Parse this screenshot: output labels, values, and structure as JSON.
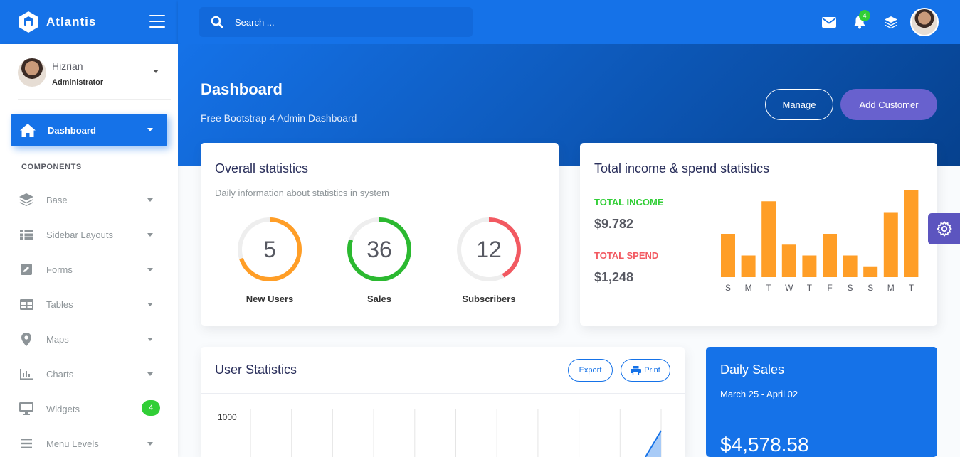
{
  "brand": {
    "name": "Atlantis"
  },
  "search": {
    "placeholder": "Search ..."
  },
  "navbar": {
    "notification_count": "4"
  },
  "user": {
    "name": "Hizrian",
    "role": "Administrator"
  },
  "sidebar": {
    "active": {
      "label": "Dashboard",
      "icon": "home-icon"
    },
    "section_label": "COMPONENTS",
    "items": [
      {
        "label": "Base",
        "icon": "layers-icon"
      },
      {
        "label": "Sidebar Layouts",
        "icon": "th-list-icon"
      },
      {
        "label": "Forms",
        "icon": "pen-square-icon"
      },
      {
        "label": "Tables",
        "icon": "table-icon"
      },
      {
        "label": "Maps",
        "icon": "map-marker-icon"
      },
      {
        "label": "Charts",
        "icon": "bar-chart-icon"
      },
      {
        "label": "Widgets",
        "icon": "desktop-icon",
        "badge": "4"
      },
      {
        "label": "Menu Levels",
        "icon": "bars-icon"
      }
    ]
  },
  "header": {
    "title": "Dashboard",
    "subtitle": "Free Bootstrap 4 Admin Dashboard",
    "manage_label": "Manage",
    "add_customer_label": "Add Customer"
  },
  "overall": {
    "title": "Overall statistics",
    "subtitle": "Daily information about statistics in system",
    "circles": [
      {
        "value": "5",
        "label": "New Users",
        "color": "#ff9e27",
        "percent": 0.7
      },
      {
        "value": "36",
        "label": "Sales",
        "color": "#2bb930",
        "percent": 0.8
      },
      {
        "value": "12",
        "label": "Subscribers",
        "color": "#f25961",
        "percent": 0.42
      }
    ]
  },
  "income": {
    "title": "Total income & spend statistics",
    "income_label": "TOTAL INCOME",
    "income_value": "$9.782",
    "spend_label": "TOTAL SPEND",
    "spend_value": "$1,248",
    "colors": {
      "income": "#31ce36",
      "spend": "#f25961",
      "bars": "#ff9e27"
    }
  },
  "chart_data": [
    {
      "type": "bar",
      "categories": [
        "S",
        "M",
        "T",
        "W",
        "T",
        "F",
        "S",
        "S",
        "M",
        "T"
      ],
      "values": [
        8,
        4,
        14,
        6,
        4,
        8,
        4,
        2,
        12,
        16
      ],
      "ylim": [
        0,
        16
      ]
    },
    {
      "type": "line",
      "y_ticks": [
        "1000"
      ]
    }
  ],
  "user_stats": {
    "title": "User Statistics",
    "export_label": "Export",
    "print_label": "Print"
  },
  "daily_sales": {
    "title": "Daily Sales",
    "range": "March 25 - April 02",
    "amount": "$4,578.58"
  }
}
